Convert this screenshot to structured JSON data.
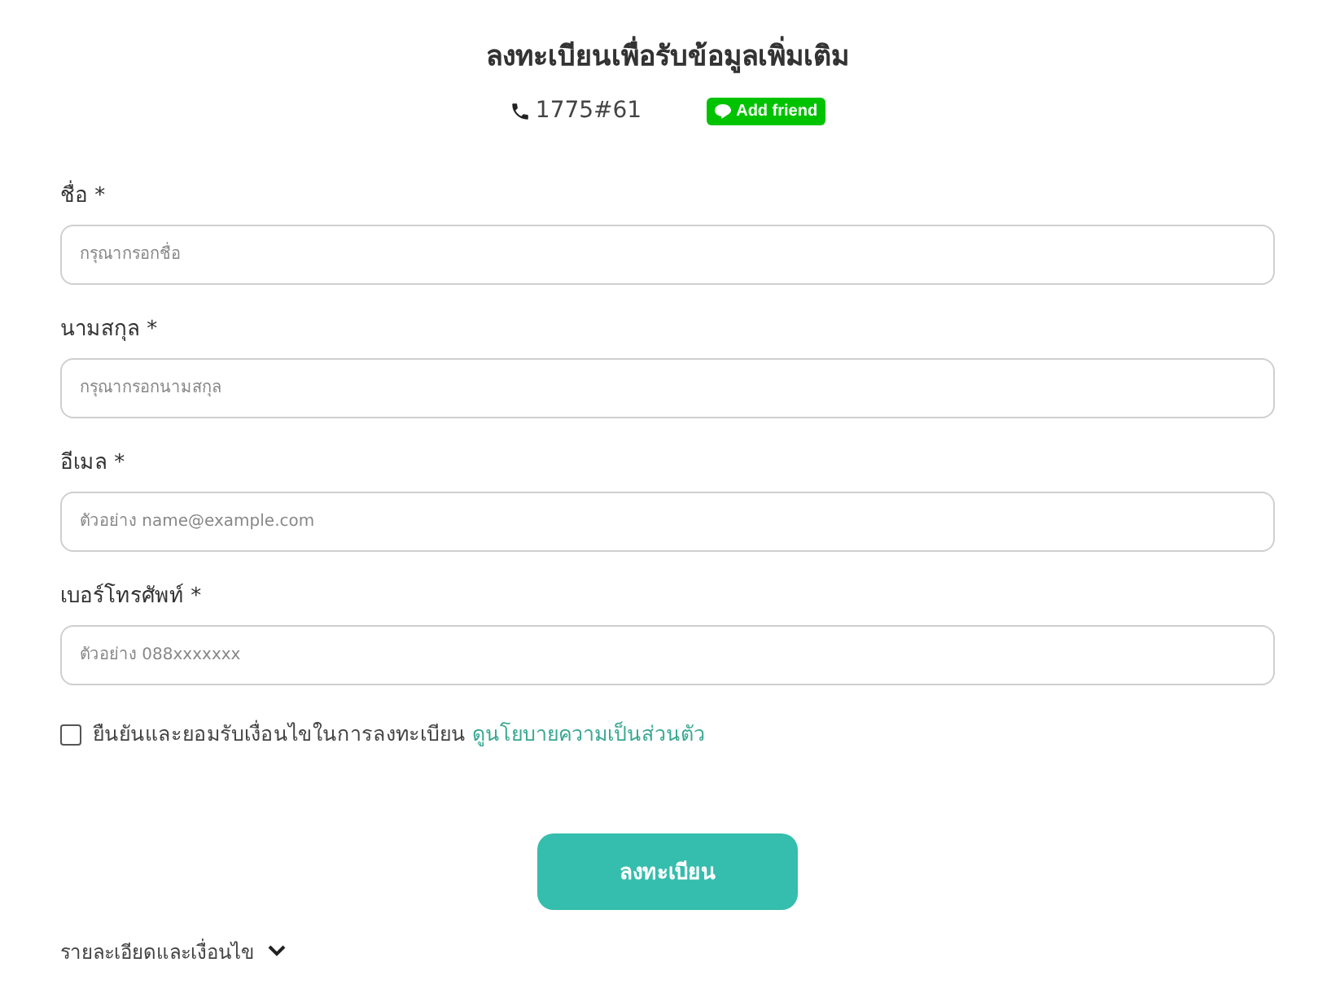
{
  "header": {
    "title": "ลงทะเบียนเพื่อรับข้อมูลเพิ่มเติม",
    "phone": "1775#61",
    "friend_button": "Add friend"
  },
  "fields": [
    {
      "label": "ชื่อ *",
      "placeholder": "กรุณากรอกชื่อ"
    },
    {
      "label": "นามสกุล *",
      "placeholder": "กรุณากรอกนามสกุล"
    },
    {
      "label": "อีเมล *",
      "placeholder": "ตัวอย่าง name@example.com"
    },
    {
      "label": "เบอร์โทรศัพท์ *",
      "placeholder": "ตัวอย่าง 088xxxxxxx"
    }
  ],
  "consent": {
    "checked": false,
    "text": "ยืนยันและยอมรับเงื่อนไขในการลงทะเบียน",
    "link": "ดูนโยบายความเป็นส่วนตัว"
  },
  "submit": "ลงทะเบียน",
  "details": {
    "label": "รายละเอียดและเงื่อนไข",
    "expanded": false
  }
}
